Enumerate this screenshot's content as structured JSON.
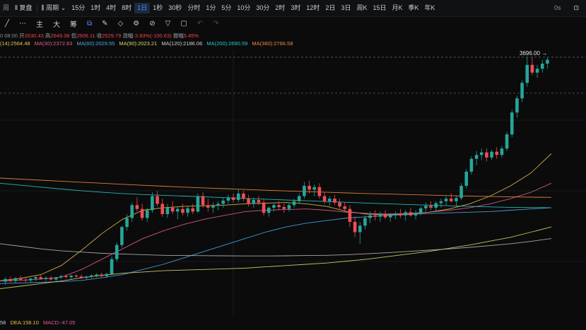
{
  "toolbar": {
    "left_partial": "周",
    "replay": "复盘",
    "period": "周期",
    "intervals": [
      "15分",
      "1时",
      "4时",
      "8时",
      "1日",
      "1秒",
      "30秒",
      "分时",
      "1分",
      "5分",
      "10分",
      "30分",
      "2时",
      "3时",
      "12时",
      "2日",
      "3日",
      "周K",
      "15日",
      "月K",
      "季K",
      "年K"
    ],
    "active_interval": "1日",
    "right_time": "0s"
  },
  "drawbar": {
    "items": [
      "主",
      "大",
      "筹"
    ]
  },
  "ohlc": {
    "time": "0 08:00",
    "open_label": "开",
    "open": "2630.43",
    "high_label": "高",
    "high": "2649.38",
    "low_label": "低",
    "low": "2506.11",
    "close_label": "收",
    "close": "2529.79",
    "change_label": "涨幅",
    "change": "-3.83%(-100.63)",
    "amp_label": "振幅",
    "amp": "5.45%"
  },
  "ma_legend": [
    {
      "label": "(14):2564.48",
      "color": "#e7c14a"
    },
    {
      "label": "MA(30):2372.63",
      "color": "#e05e8e"
    },
    {
      "label": "MA(60):2029.55",
      "color": "#4aa8e8"
    },
    {
      "label": "MA(90):2023.21",
      "color": "#d8d86a"
    },
    {
      "label": "MA(120):2186.06",
      "color": "#d0d0d0"
    },
    {
      "label": "MA(200):2690.59",
      "color": "#2ec6c6"
    },
    {
      "label": "MA(360):2766.58",
      "color": "#f08a3c"
    }
  ],
  "price_tag": "3696.00",
  "macd_legend": [
    {
      "label": "58",
      "color": "#c9ccd2"
    },
    {
      "label": "DEA:158.10",
      "color": "#e7c14a"
    },
    {
      "label": "MACD:-47.05",
      "color": "#e05e8e"
    }
  ],
  "colors": {
    "up": "#26a69a",
    "down": "#ef4e55",
    "accent": "#4e90ff",
    "background": "#0b0b0c"
  },
  "chart_data": {
    "type": "candlestick",
    "title": "",
    "ylim": [
      1700,
      3760
    ],
    "grid": true,
    "candles": [
      {
        "o": 1955,
        "h": 1990,
        "l": 1930,
        "c": 1975
      },
      {
        "o": 1975,
        "h": 1995,
        "l": 1950,
        "c": 1960
      },
      {
        "o": 1960,
        "h": 1990,
        "l": 1945,
        "c": 1982
      },
      {
        "o": 1982,
        "h": 2000,
        "l": 1960,
        "c": 1970
      },
      {
        "o": 1970,
        "h": 1990,
        "l": 1950,
        "c": 1965
      },
      {
        "o": 1965,
        "h": 1985,
        "l": 1945,
        "c": 1978
      },
      {
        "o": 1978,
        "h": 2000,
        "l": 1960,
        "c": 1990
      },
      {
        "o": 1990,
        "h": 2005,
        "l": 1970,
        "c": 1975
      },
      {
        "o": 1975,
        "h": 1995,
        "l": 1960,
        "c": 1985
      },
      {
        "o": 1985,
        "h": 2000,
        "l": 1965,
        "c": 1972
      },
      {
        "o": 1972,
        "h": 1992,
        "l": 1958,
        "c": 1988
      },
      {
        "o": 1988,
        "h": 2008,
        "l": 1975,
        "c": 1998
      },
      {
        "o": 1998,
        "h": 2012,
        "l": 1982,
        "c": 1990
      },
      {
        "o": 1990,
        "h": 2010,
        "l": 1975,
        "c": 2002
      },
      {
        "o": 2002,
        "h": 2015,
        "l": 1985,
        "c": 1995
      },
      {
        "o": 1995,
        "h": 2010,
        "l": 1978,
        "c": 1985
      },
      {
        "o": 1985,
        "h": 2002,
        "l": 1970,
        "c": 1995
      },
      {
        "o": 1995,
        "h": 2012,
        "l": 1980,
        "c": 2003
      },
      {
        "o": 2003,
        "h": 2020,
        "l": 1988,
        "c": 2010
      },
      {
        "o": 2010,
        "h": 2025,
        "l": 1990,
        "c": 1998
      },
      {
        "o": 1998,
        "h": 2025,
        "l": 1985,
        "c": 2015
      },
      {
        "o": 2015,
        "h": 2150,
        "l": 2005,
        "c": 2130
      },
      {
        "o": 2130,
        "h": 2260,
        "l": 2110,
        "c": 2240
      },
      {
        "o": 2240,
        "h": 2390,
        "l": 2220,
        "c": 2380
      },
      {
        "o": 2380,
        "h": 2480,
        "l": 2350,
        "c": 2450
      },
      {
        "o": 2450,
        "h": 2570,
        "l": 2420,
        "c": 2550
      },
      {
        "o": 2550,
        "h": 2610,
        "l": 2500,
        "c": 2520
      },
      {
        "o": 2520,
        "h": 2560,
        "l": 2430,
        "c": 2450
      },
      {
        "o": 2450,
        "h": 2530,
        "l": 2420,
        "c": 2510
      },
      {
        "o": 2510,
        "h": 2650,
        "l": 2490,
        "c": 2620
      },
      {
        "o": 2620,
        "h": 2660,
        "l": 2540,
        "c": 2560
      },
      {
        "o": 2560,
        "h": 2600,
        "l": 2460,
        "c": 2480
      },
      {
        "o": 2480,
        "h": 2560,
        "l": 2450,
        "c": 2530
      },
      {
        "o": 2530,
        "h": 2580,
        "l": 2480,
        "c": 2500
      },
      {
        "o": 2500,
        "h": 2540,
        "l": 2440,
        "c": 2520
      },
      {
        "o": 2520,
        "h": 2560,
        "l": 2470,
        "c": 2490
      },
      {
        "o": 2490,
        "h": 2540,
        "l": 2460,
        "c": 2525
      },
      {
        "o": 2525,
        "h": 2560,
        "l": 2480,
        "c": 2500
      },
      {
        "o": 2500,
        "h": 2640,
        "l": 2490,
        "c": 2620
      },
      {
        "o": 2620,
        "h": 2650,
        "l": 2530,
        "c": 2550
      },
      {
        "o": 2550,
        "h": 2600,
        "l": 2500,
        "c": 2530
      },
      {
        "o": 2530,
        "h": 2570,
        "l": 2490,
        "c": 2545
      },
      {
        "o": 2545,
        "h": 2580,
        "l": 2510,
        "c": 2560
      },
      {
        "o": 2560,
        "h": 2610,
        "l": 2530,
        "c": 2585
      },
      {
        "o": 2585,
        "h": 2630,
        "l": 2560,
        "c": 2610
      },
      {
        "o": 2610,
        "h": 2640,
        "l": 2570,
        "c": 2590
      },
      {
        "o": 2590,
        "h": 2670,
        "l": 2570,
        "c": 2640
      },
      {
        "o": 2640,
        "h": 2660,
        "l": 2580,
        "c": 2600
      },
      {
        "o": 2600,
        "h": 2630,
        "l": 2540,
        "c": 2560
      },
      {
        "o": 2560,
        "h": 2610,
        "l": 2530,
        "c": 2590
      },
      {
        "o": 2590,
        "h": 2620,
        "l": 2550,
        "c": 2570
      },
      {
        "o": 2570,
        "h": 2600,
        "l": 2470,
        "c": 2490
      },
      {
        "o": 2490,
        "h": 2540,
        "l": 2460,
        "c": 2530
      },
      {
        "o": 2530,
        "h": 2570,
        "l": 2500,
        "c": 2550
      },
      {
        "o": 2550,
        "h": 2580,
        "l": 2510,
        "c": 2535
      },
      {
        "o": 2535,
        "h": 2560,
        "l": 2490,
        "c": 2520
      },
      {
        "o": 2520,
        "h": 2570,
        "l": 2500,
        "c": 2550
      },
      {
        "o": 2550,
        "h": 2600,
        "l": 2530,
        "c": 2580
      },
      {
        "o": 2580,
        "h": 2640,
        "l": 2560,
        "c": 2620
      },
      {
        "o": 2620,
        "h": 2730,
        "l": 2600,
        "c": 2700
      },
      {
        "o": 2700,
        "h": 2740,
        "l": 2640,
        "c": 2670
      },
      {
        "o": 2670,
        "h": 2710,
        "l": 2620,
        "c": 2690
      },
      {
        "o": 2690,
        "h": 2720,
        "l": 2600,
        "c": 2620
      },
      {
        "o": 2620,
        "h": 2650,
        "l": 2560,
        "c": 2580
      },
      {
        "o": 2580,
        "h": 2620,
        "l": 2540,
        "c": 2600
      },
      {
        "o": 2600,
        "h": 2630,
        "l": 2550,
        "c": 2570
      },
      {
        "o": 2570,
        "h": 2600,
        "l": 2520,
        "c": 2540
      },
      {
        "o": 2540,
        "h": 2570,
        "l": 2500,
        "c": 2520
      },
      {
        "o": 2520,
        "h": 2550,
        "l": 2380,
        "c": 2420
      },
      {
        "o": 2420,
        "h": 2460,
        "l": 2300,
        "c": 2340
      },
      {
        "o": 2340,
        "h": 2420,
        "l": 2250,
        "c": 2390
      },
      {
        "o": 2390,
        "h": 2470,
        "l": 2360,
        "c": 2450
      },
      {
        "o": 2450,
        "h": 2500,
        "l": 2410,
        "c": 2470
      },
      {
        "o": 2470,
        "h": 2510,
        "l": 2430,
        "c": 2460
      },
      {
        "o": 2460,
        "h": 2500,
        "l": 2420,
        "c": 2480
      },
      {
        "o": 2480,
        "h": 2510,
        "l": 2440,
        "c": 2455
      },
      {
        "o": 2455,
        "h": 2490,
        "l": 2420,
        "c": 2470
      },
      {
        "o": 2470,
        "h": 2500,
        "l": 2440,
        "c": 2485
      },
      {
        "o": 2485,
        "h": 2520,
        "l": 2450,
        "c": 2470
      },
      {
        "o": 2470,
        "h": 2510,
        "l": 2430,
        "c": 2495
      },
      {
        "o": 2495,
        "h": 2530,
        "l": 2460,
        "c": 2470
      },
      {
        "o": 2470,
        "h": 2510,
        "l": 2440,
        "c": 2490
      },
      {
        "o": 2490,
        "h": 2540,
        "l": 2470,
        "c": 2525
      },
      {
        "o": 2525,
        "h": 2570,
        "l": 2500,
        "c": 2545
      },
      {
        "o": 2545,
        "h": 2580,
        "l": 2510,
        "c": 2530
      },
      {
        "o": 2530,
        "h": 2580,
        "l": 2500,
        "c": 2565
      },
      {
        "o": 2565,
        "h": 2600,
        "l": 2530,
        "c": 2580
      },
      {
        "o": 2580,
        "h": 2620,
        "l": 2550,
        "c": 2600
      },
      {
        "o": 2600,
        "h": 2640,
        "l": 2570,
        "c": 2580
      },
      {
        "o": 2580,
        "h": 2620,
        "l": 2540,
        "c": 2605
      },
      {
        "o": 2605,
        "h": 2720,
        "l": 2590,
        "c": 2700
      },
      {
        "o": 2700,
        "h": 2830,
        "l": 2680,
        "c": 2810
      },
      {
        "o": 2810,
        "h": 2930,
        "l": 2790,
        "c": 2910
      },
      {
        "o": 2910,
        "h": 2970,
        "l": 2860,
        "c": 2940
      },
      {
        "o": 2940,
        "h": 2990,
        "l": 2900,
        "c": 2960
      },
      {
        "o": 2960,
        "h": 2990,
        "l": 2890,
        "c": 2920
      },
      {
        "o": 2920,
        "h": 2980,
        "l": 2900,
        "c": 2965
      },
      {
        "o": 2965,
        "h": 3000,
        "l": 2910,
        "c": 2940
      },
      {
        "o": 2940,
        "h": 3010,
        "l": 2920,
        "c": 2990
      },
      {
        "o": 2990,
        "h": 3120,
        "l": 2970,
        "c": 3100
      },
      {
        "o": 3100,
        "h": 3290,
        "l": 3080,
        "c": 3270
      },
      {
        "o": 3270,
        "h": 3400,
        "l": 3230,
        "c": 3380
      },
      {
        "o": 3380,
        "h": 3520,
        "l": 3350,
        "c": 3500
      },
      {
        "o": 3500,
        "h": 3700,
        "l": 3470,
        "c": 3640
      },
      {
        "o": 3640,
        "h": 3700,
        "l": 3560,
        "c": 3580
      },
      {
        "o": 3580,
        "h": 3640,
        "l": 3540,
        "c": 3610
      },
      {
        "o": 3610,
        "h": 3680,
        "l": 3580,
        "c": 3650
      },
      {
        "o": 3650,
        "h": 3696,
        "l": 3610,
        "c": 3680
      }
    ],
    "ma_lines": [
      {
        "name": "MA(14)",
        "color": "#e7c14a",
        "values": [
          1962,
          1980,
          2010,
          2080,
          2200,
          2330,
          2440,
          2510,
          2530,
          2540,
          2545,
          2550,
          2560,
          2565,
          2570,
          2560,
          2540,
          2500,
          2480,
          2475,
          2480,
          2495,
          2520,
          2560,
          2620,
          2700,
          2800,
          2950
        ]
      },
      {
        "name": "MA(30)",
        "color": "#e05e8e",
        "values": [
          1960,
          1965,
          1975,
          1990,
          2050,
          2130,
          2210,
          2290,
          2350,
          2400,
          2440,
          2470,
          2500,
          2510,
          2515,
          2520,
          2510,
          2495,
          2485,
          2480,
          2485,
          2495,
          2510,
          2530,
          2560,
          2600,
          2650,
          2720
        ]
      },
      {
        "name": "MA(60)",
        "color": "#4aa8e8",
        "values": [
          1940,
          1945,
          1950,
          1955,
          1965,
          1985,
          2010,
          2050,
          2090,
          2140,
          2190,
          2240,
          2290,
          2340,
          2380,
          2410,
          2430,
          2450,
          2460,
          2470,
          2478,
          2485,
          2490,
          2495,
          2500,
          2510,
          2520,
          2530
        ]
      },
      {
        "name": "MA(90)",
        "color": "#d8d86a",
        "values": [
          1900,
          1920,
          1940,
          1960,
          1985,
          2005,
          2020,
          2030,
          2040,
          2045,
          2050,
          2055,
          2060,
          2070,
          2080,
          2090,
          2100,
          2115,
          2130,
          2150,
          2170,
          2190,
          2215,
          2240,
          2270,
          2300,
          2340,
          2380
        ]
      },
      {
        "name": "MA(120)",
        "color": "#b8b8b8",
        "values": [
          2250,
          2230,
          2210,
          2195,
          2185,
          2175,
          2170,
          2165,
          2160,
          2158,
          2157,
          2156,
          2155,
          2155,
          2156,
          2158,
          2160,
          2165,
          2172,
          2180,
          2190,
          2200,
          2210,
          2222,
          2235,
          2250,
          2268,
          2290
        ]
      },
      {
        "name": "MA(200)",
        "color": "#2ec6c6",
        "values": [
          2720,
          2705,
          2690,
          2675,
          2662,
          2650,
          2640,
          2632,
          2626,
          2620,
          2614,
          2608,
          2602,
          2596,
          2590,
          2584,
          2578,
          2572,
          2566,
          2560,
          2555,
          2550,
          2545,
          2540,
          2536,
          2533,
          2531,
          2530
        ]
      },
      {
        "name": "MA(360)",
        "color": "#f08a3c",
        "values": [
          2760,
          2752,
          2744,
          2736,
          2728,
          2720,
          2712,
          2704,
          2697,
          2690,
          2684,
          2678,
          2672,
          2666,
          2660,
          2655,
          2650,
          2645,
          2640,
          2636,
          2632,
          2628,
          2624,
          2620,
          2617,
          2614,
          2612,
          2610
        ]
      }
    ],
    "h_lines": [
      3700,
      3420
    ]
  }
}
